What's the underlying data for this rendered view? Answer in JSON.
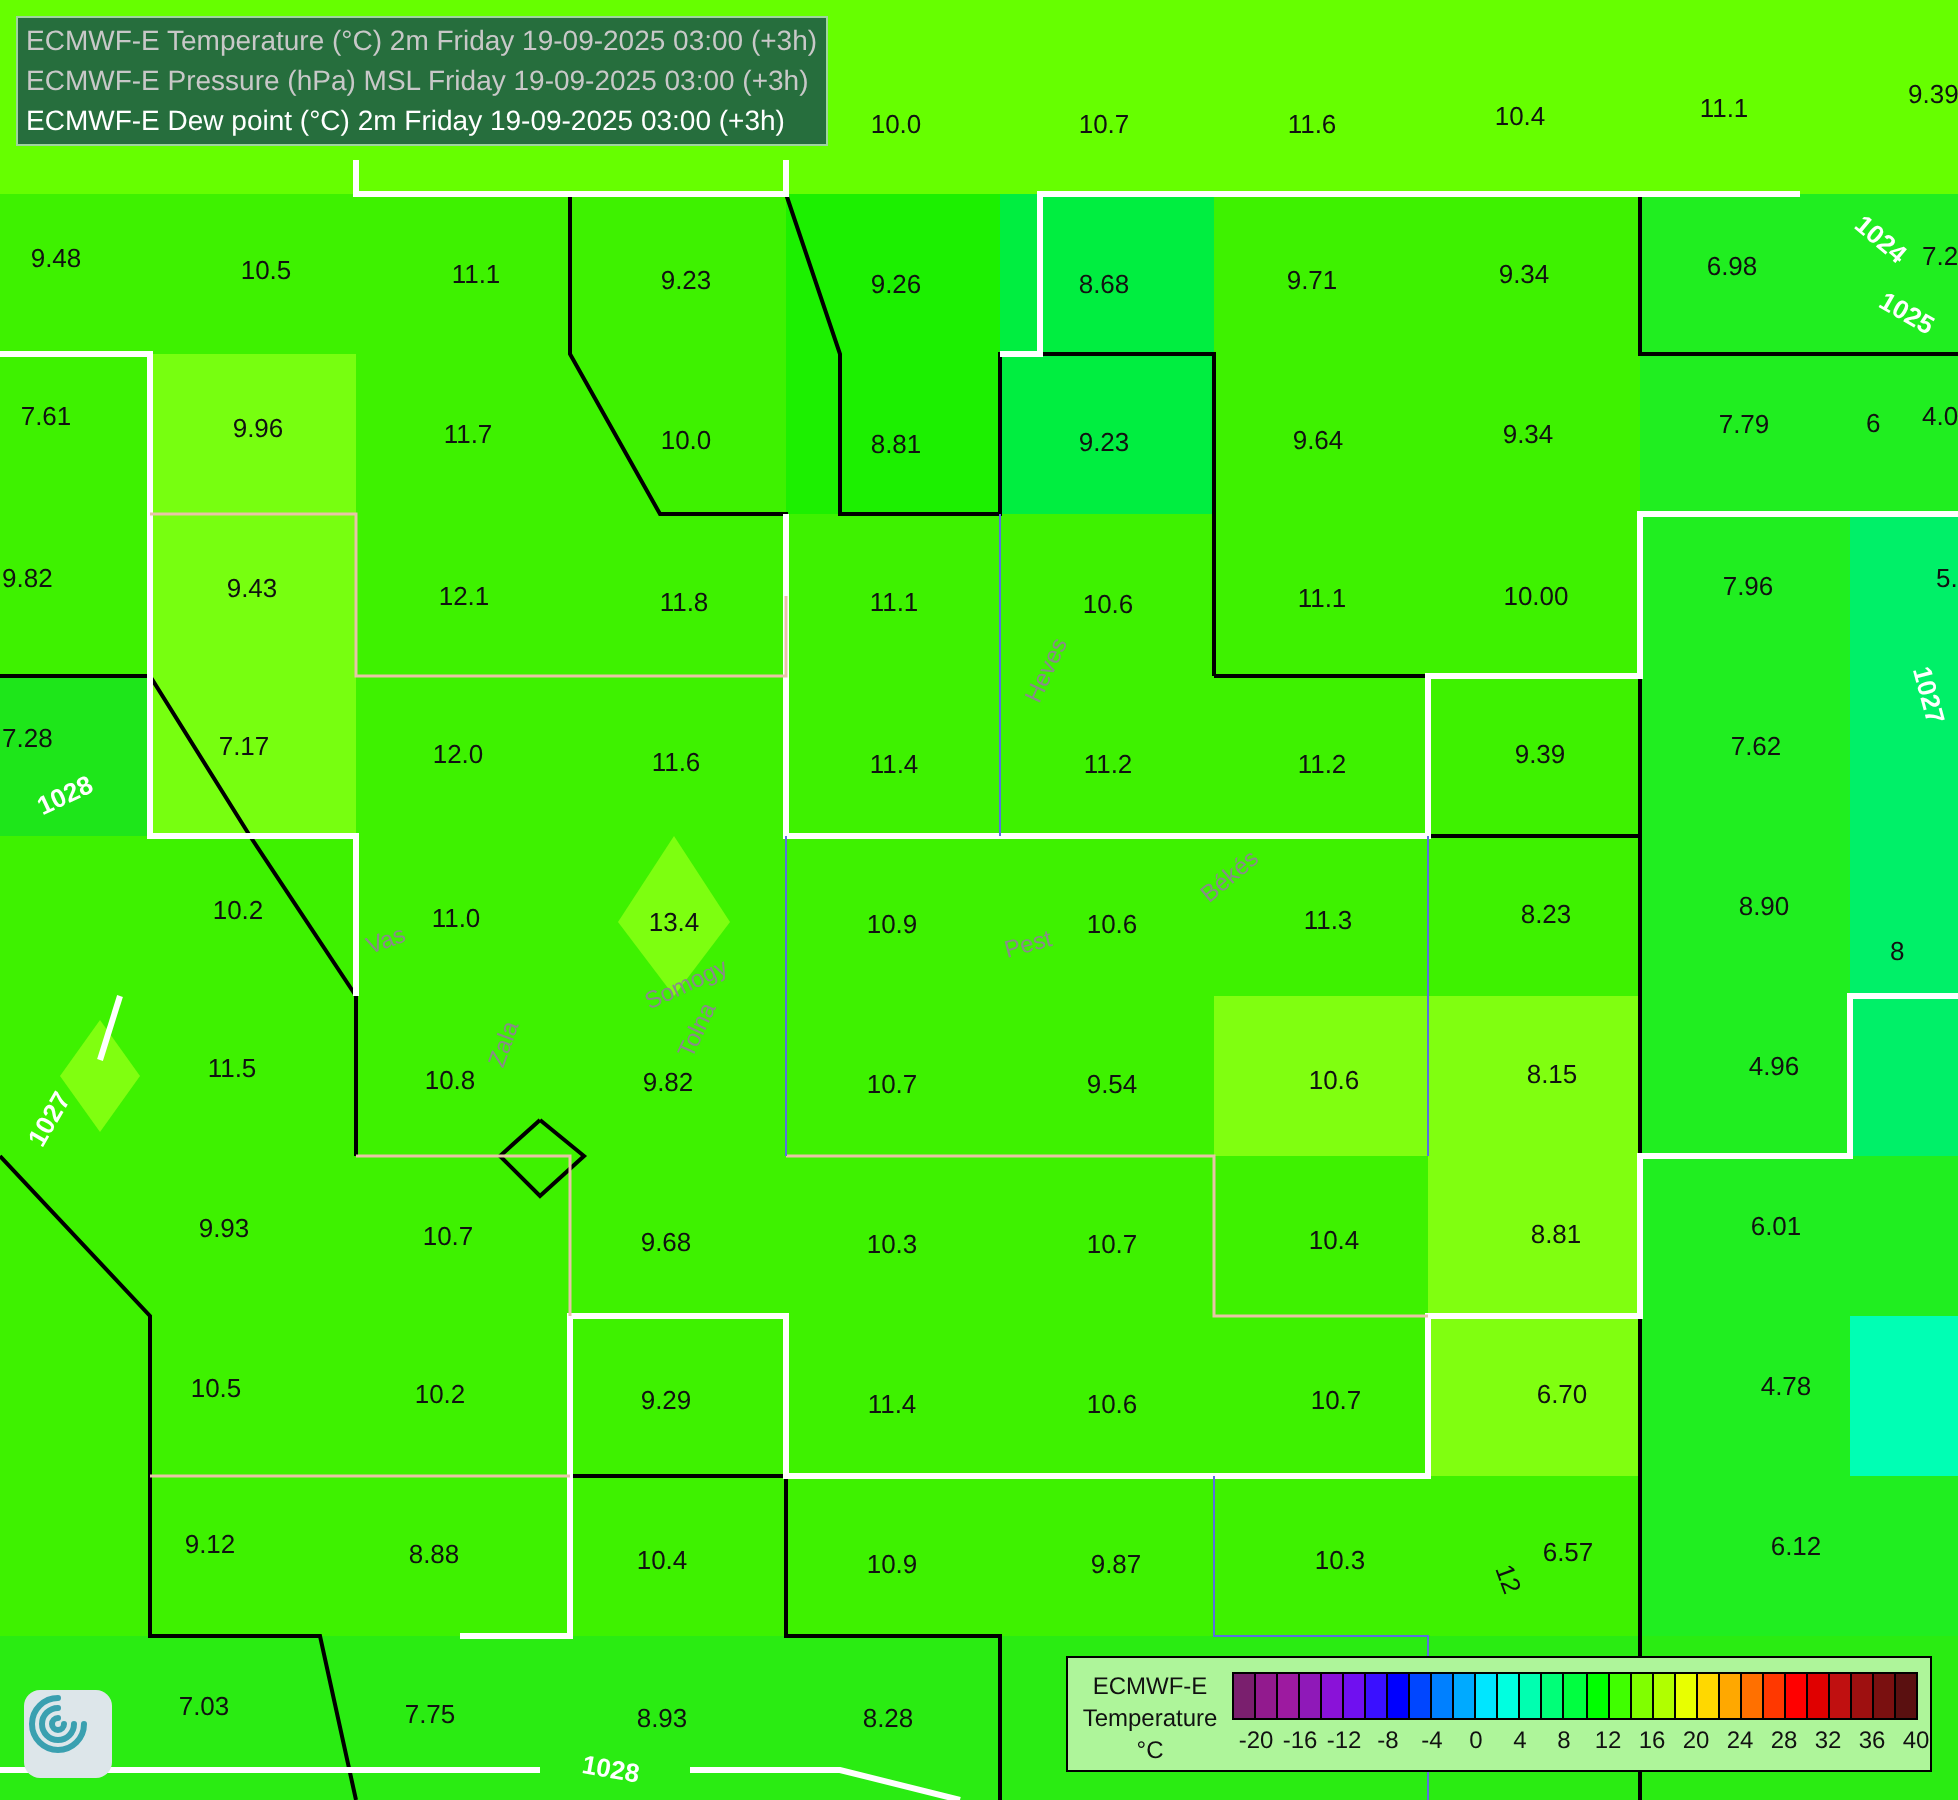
{
  "layers": [
    {
      "label": "ECMWF-E Temperature (°C) 2m Friday 19-09-2025 03:00 (+3h)",
      "active": false
    },
    {
      "label": "ECMWF-E Pressure (hPa) MSL Friday 19-09-2025 03:00 (+3h)",
      "active": false
    },
    {
      "label": "ECMWF-E Dew point (°C) 2m Friday 19-09-2025 03:00 (+3h)",
      "active": true
    }
  ],
  "map": {
    "values": [
      "10.0",
      "10.7",
      "11.6",
      "10.4",
      "11.1",
      "9.39",
      "9.48",
      "10.5",
      "11.1",
      "9.23",
      "9.26",
      "8.68",
      "9.71",
      "9.34",
      "6.98",
      "7.2",
      "7.61",
      "9.96",
      "11.7",
      "10.0",
      "8.81",
      "9.23",
      "9.64",
      "9.34",
      "7.79",
      "4.0",
      "9.82",
      "9.43",
      "12.1",
      "11.8",
      "11.1",
      "10.6",
      "11.1",
      "10.00",
      "7.96",
      "5.",
      "7.28",
      "7.17",
      "12.0",
      "11.6",
      "11.4",
      "11.2",
      "11.2",
      "9.39",
      "7.62",
      "10.2",
      "11.0",
      "13.4",
      "10.9",
      "10.6",
      "11.3",
      "8.23",
      "8.90",
      "11.5",
      "10.8",
      "9.82",
      "10.7",
      "9.54",
      "10.6",
      "8.15",
      "4.96",
      "9.93",
      "10.7",
      "9.68",
      "10.3",
      "10.7",
      "10.4",
      "8.81",
      "6.01",
      "10.5",
      "10.2",
      "9.29",
      "11.4",
      "10.6",
      "10.7",
      "6.70",
      "4.78",
      "9.12",
      "8.88",
      "10.4",
      "10.9",
      "9.87",
      "10.3",
      "6.57",
      "6.12",
      "7.03",
      "7.75",
      "8.93",
      "8.28"
    ],
    "isobar_labels": [
      "1028",
      "1027",
      "1028",
      "1024",
      "1025",
      "1027"
    ],
    "contour_labels": [
      "12",
      "8",
      "6"
    ],
    "region_names": [
      "Vas",
      "Zala",
      "Somogy",
      "Tolna",
      "Pest",
      "Heves",
      "Békés"
    ]
  },
  "legend": {
    "title": "ECMWF-E",
    "variable": "Temperature",
    "unit": "°C",
    "swatches": [
      {
        "color": "#7a1f6e"
      },
      {
        "color": "#921a8e"
      },
      {
        "color": "#9d1aa0"
      },
      {
        "color": "#8f19b8"
      },
      {
        "color": "#8a12d8"
      },
      {
        "color": "#7010f0"
      },
      {
        "color": "#3a10ff"
      },
      {
        "color": "#0000ff"
      },
      {
        "color": "#0046ff"
      },
      {
        "color": "#0080ff"
      },
      {
        "color": "#00aaff"
      },
      {
        "color": "#00e6ff"
      },
      {
        "color": "#00ffe0"
      },
      {
        "color": "#00ffb0"
      },
      {
        "color": "#00ff78"
      },
      {
        "color": "#00ff40"
      },
      {
        "color": "#00ff00"
      },
      {
        "color": "#40ff00"
      },
      {
        "color": "#80ff00"
      },
      {
        "color": "#b0ff00"
      },
      {
        "color": "#e8ff00"
      },
      {
        "color": "#ffd800"
      },
      {
        "color": "#ffa800"
      },
      {
        "color": "#ff7000"
      },
      {
        "color": "#ff3800"
      },
      {
        "color": "#ff0000"
      },
      {
        "color": "#e00000"
      },
      {
        "color": "#c01010"
      },
      {
        "color": "#9e1010"
      },
      {
        "color": "#7a1010"
      },
      {
        "color": "#5a1010"
      }
    ],
    "ticks": [
      "-20",
      "-16",
      "-12",
      "-8",
      "-4",
      "0",
      "4",
      "8",
      "12",
      "16",
      "20",
      "24",
      "28",
      "32",
      "36",
      "40"
    ]
  }
}
